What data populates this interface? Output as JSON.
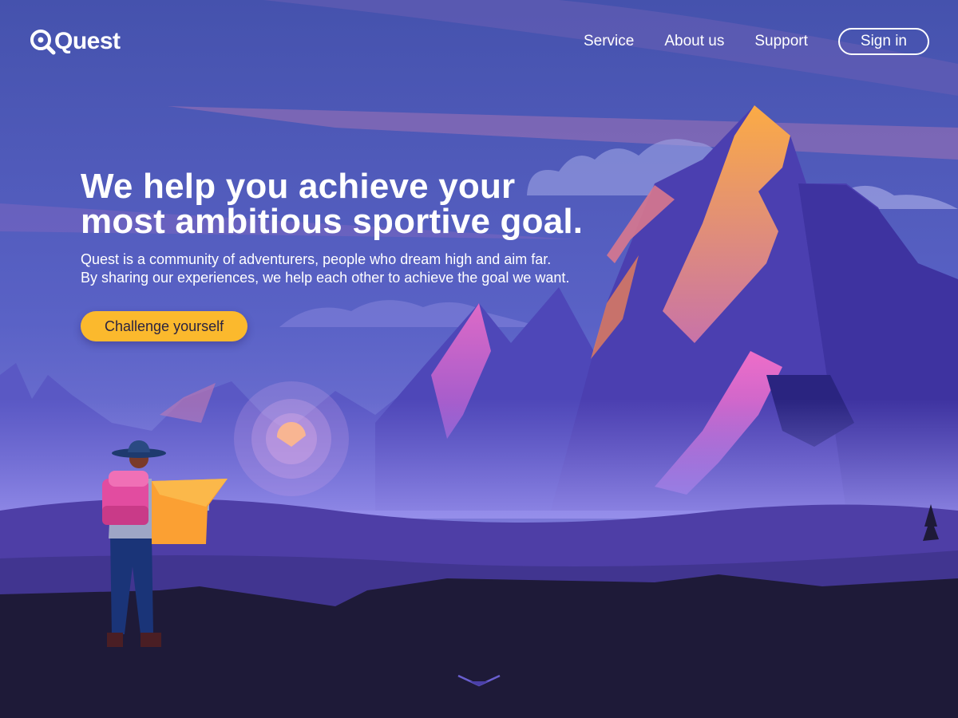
{
  "brand": {
    "name": "Quest"
  },
  "nav": {
    "items": [
      {
        "label": "Service"
      },
      {
        "label": "About us"
      },
      {
        "label": "Support"
      }
    ],
    "signin_label": "Sign in"
  },
  "hero": {
    "headline_line1": "We help you achieve your",
    "headline_line2": "most ambitious sportive goal.",
    "sub_line1": "Quest is a community of adventurers, people who dream high and aim far.",
    "sub_line2": "By sharing our experiences, we help each other to achieve the goal we want.",
    "cta_label": "Challenge yourself"
  },
  "icons": {
    "logo": "search-magnifier-icon",
    "scroll": "chevron-down-icon"
  },
  "colors": {
    "accent": "#fbb92d",
    "sky_top": "#4a55b8",
    "sky_bottom": "#7a78d8",
    "ground_dark": "#1e1a38",
    "peak_orange": "#fb9e48",
    "peak_pink": "#e86cc2"
  }
}
